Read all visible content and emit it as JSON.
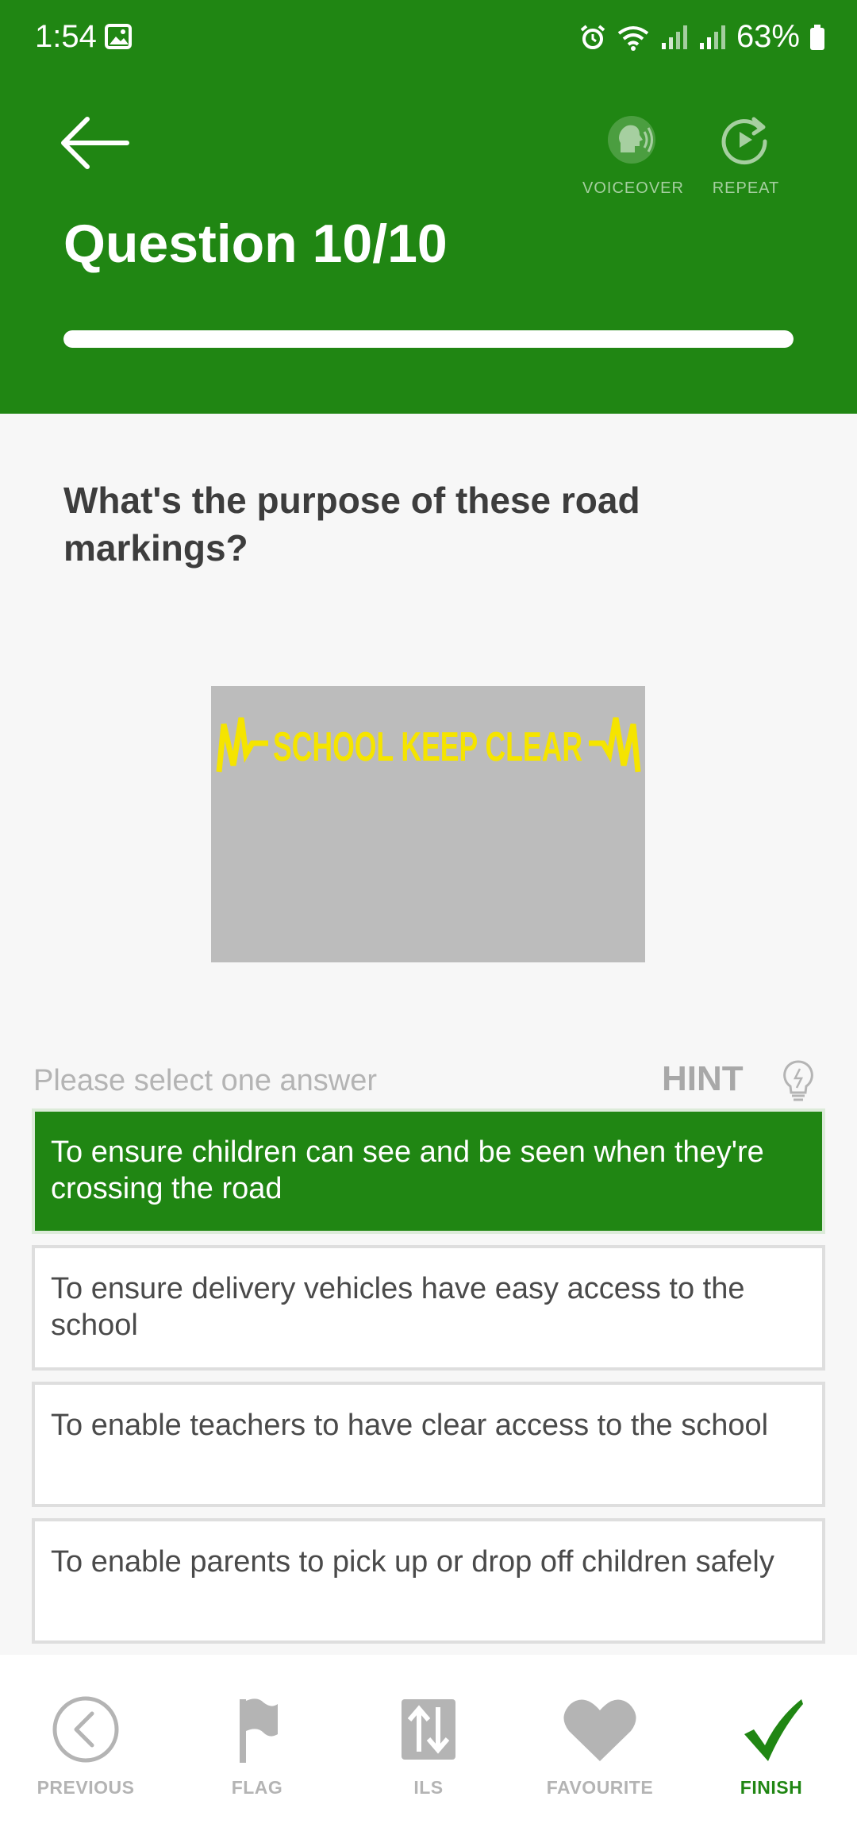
{
  "status_bar": {
    "time": "1:54",
    "battery": "63%"
  },
  "header": {
    "title": "Question 10/10",
    "progress": 1.0,
    "voiceover_label": "VOICEOVER",
    "repeat_label": "REPEAT"
  },
  "question": {
    "text": "What's the purpose of these road markings?",
    "image_text": "SCHOOL KEEP CLEAR"
  },
  "answers_section": {
    "prompt": "Please select one answer",
    "hint_label": "HINT",
    "options": [
      {
        "text": "To ensure children can see and be seen when they're crossing the road",
        "selected": true
      },
      {
        "text": "To ensure delivery vehicles have easy access to the school",
        "selected": false
      },
      {
        "text": "To enable teachers to have clear access to the school",
        "selected": false
      },
      {
        "text": "To enable parents to pick up or drop off children safely",
        "selected": false
      }
    ]
  },
  "bottom_nav": {
    "previous": "PREVIOUS",
    "flag": "FLAG",
    "ils": "ILS",
    "favourite": "FAVOURITE",
    "finish": "FINISH"
  },
  "colors": {
    "primary_green": "#208613",
    "marking_yellow": "#f5e400",
    "road_grey": "#bcbcbc"
  }
}
